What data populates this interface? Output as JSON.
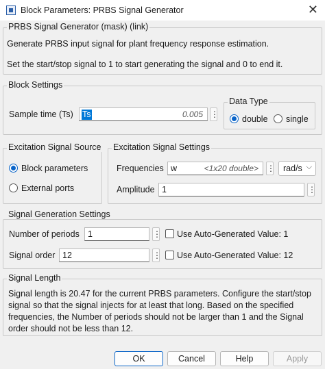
{
  "window": {
    "title": "Block Parameters: PRBS Signal Generator",
    "close_glyph": "✕",
    "icon": "simulink-block-icon"
  },
  "mask": {
    "heading": "PRBS Signal Generator (mask) (link)",
    "description_1": "Generate PRBS input signal for plant frequency response estimation.",
    "description_2": "Set the start/stop signal to 1 to start generating the signal and 0 to end it."
  },
  "block_settings": {
    "legend": "Block Settings",
    "sample_time_label": "Sample time (Ts)",
    "sample_time_value": "Ts",
    "sample_time_hint": "0.005",
    "data_type_legend": "Data Type",
    "data_type_options": [
      "double",
      "single"
    ],
    "data_type_selected": "double"
  },
  "excitation_source": {
    "legend": "Excitation Signal Source",
    "options": [
      "Block parameters",
      "External ports"
    ],
    "selected": "Block parameters"
  },
  "excitation_settings": {
    "legend": "Excitation Signal Settings",
    "frequencies_label": "Frequencies",
    "frequencies_value": "w",
    "frequencies_hint": "<1x20 double>",
    "frequencies_unit": "rad/s",
    "amplitude_label": "Amplitude",
    "amplitude_value": "1"
  },
  "generation": {
    "legend": "Signal Generation Settings",
    "periods_label": "Number of periods",
    "periods_value": "1",
    "periods_auto_label": "Use Auto-Generated Value: 1",
    "periods_auto_checked": false,
    "order_label": "Signal order",
    "order_value": "12",
    "order_auto_label": "Use Auto-Generated Value: 12",
    "order_auto_checked": false
  },
  "signal_length": {
    "legend": "Signal Length",
    "lines": [
      "Signal length is 20.47 for the current PRBS parameters. Configure the start/stop",
      "signal so that the signal injects for at least that long. Based on the specified",
      "frequencies, the Number of periods should not be larger than 1 and the Signal",
      "order should not be less than 12."
    ]
  },
  "buttons": {
    "ok": "OK",
    "cancel": "Cancel",
    "help": "Help",
    "apply": "Apply"
  },
  "glyphs": {
    "kebab": "⋮",
    "chevron": "⌵"
  }
}
